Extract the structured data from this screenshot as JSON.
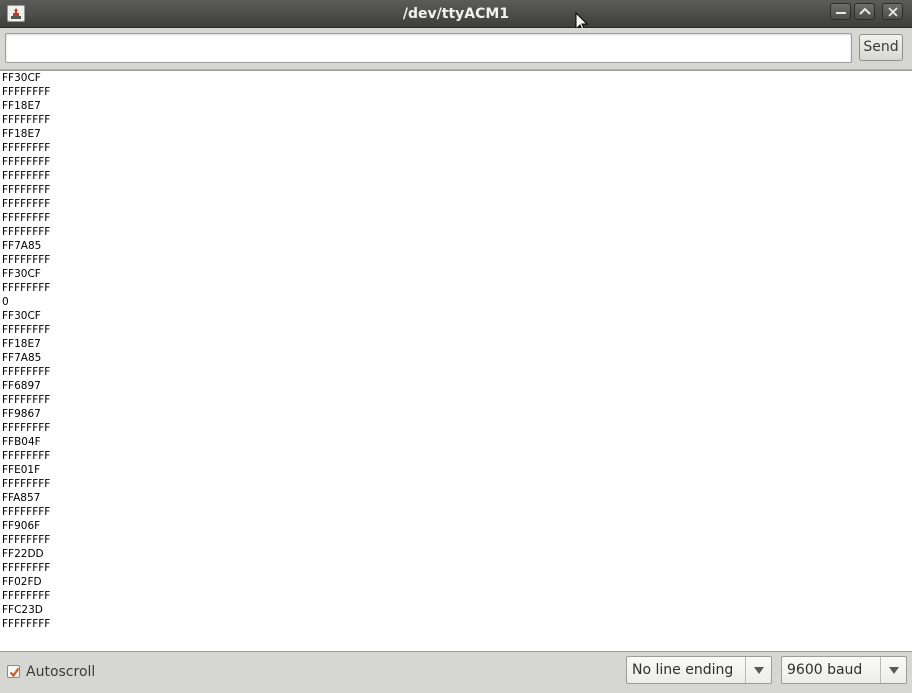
{
  "window": {
    "title": "/dev/ttyACM1",
    "icons": [
      "app-icon",
      "minimize-icon",
      "maximize-icon",
      "close-icon"
    ]
  },
  "toolbar": {
    "input_value": "",
    "send_label": "Send"
  },
  "console": {
    "lines": [
      "FF30CF",
      "FFFFFFFF",
      "FF18E7",
      "FFFFFFFF",
      "FF18E7",
      "FFFFFFFF",
      "FFFFFFFF",
      "FFFFFFFF",
      "FFFFFFFF",
      "FFFFFFFF",
      "FFFFFFFF",
      "FFFFFFFF",
      "FF7A85",
      "FFFFFFFF",
      "FF30CF",
      "FFFFFFFF",
      "0",
      "FF30CF",
      "FFFFFFFF",
      "FF18E7",
      "FF7A85",
      "FFFFFFFF",
      "FF6897",
      "FFFFFFFF",
      "FF9867",
      "FFFFFFFF",
      "FFB04F",
      "FFFFFFFF",
      "FFE01F",
      "FFFFFFFF",
      "FFA857",
      "FFFFFFFF",
      "FF906F",
      "FFFFFFFF",
      "FF22DD",
      "FFFFFFFF",
      "FF02FD",
      "FFFFFFFF",
      "FFC23D",
      "FFFFFFFF"
    ]
  },
  "statusbar": {
    "autoscroll_label": "Autoscroll",
    "autoscroll_checked": true,
    "line_ending_selected": "No line ending",
    "baud_selected": "9600 baud"
  },
  "colors": {
    "titlebar": "#4a4a48",
    "checkmark": "#d05a1e"
  }
}
